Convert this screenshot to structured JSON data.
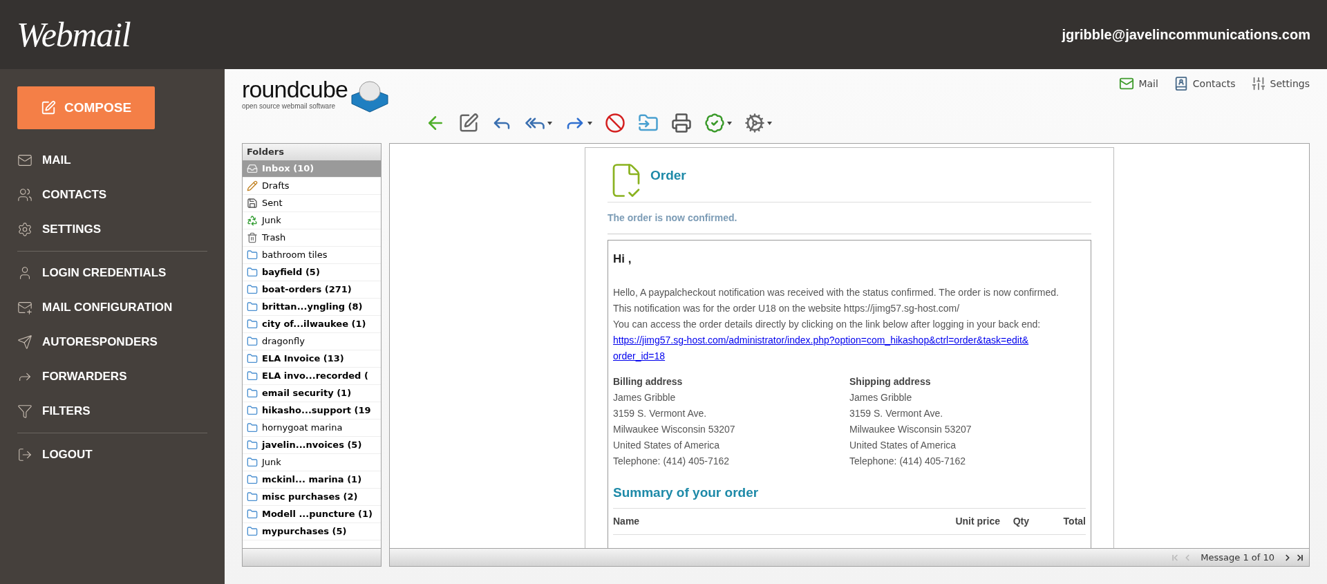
{
  "header": {
    "brand": "Webmail",
    "user": "jgribble@javelincommunications.com"
  },
  "sidebar": {
    "compose": "COMPOSE",
    "groups": [
      [
        "MAIL",
        "CONTACTS",
        "SETTINGS"
      ],
      [
        "LOGIN CREDENTIALS",
        "MAIL CONFIGURATION",
        "AUTORESPONDERS",
        "FORWARDERS",
        "FILTERS"
      ],
      [
        "LOGOUT"
      ]
    ]
  },
  "logo": {
    "name": "roundcube",
    "tagline": "open source webmail software"
  },
  "top_nav": [
    "Mail",
    "Contacts",
    "Settings"
  ],
  "folders": {
    "title": "Folders",
    "items": [
      {
        "kind": "inbox",
        "name": "Inbox (10)",
        "unread": true,
        "selected": true
      },
      {
        "kind": "drafts",
        "name": "Drafts",
        "unread": false,
        "selected": false
      },
      {
        "kind": "sent",
        "name": "Sent",
        "unread": false,
        "selected": false
      },
      {
        "kind": "junk",
        "name": "Junk",
        "unread": false,
        "selected": false
      },
      {
        "kind": "trash",
        "name": "Trash",
        "unread": false,
        "selected": false
      },
      {
        "kind": "folder",
        "name": "bathroom tiles",
        "unread": false,
        "selected": false
      },
      {
        "kind": "folder",
        "name": "bayfield (5)",
        "unread": true,
        "selected": false
      },
      {
        "kind": "folder",
        "name": "boat-orders (271)",
        "unread": true,
        "selected": false
      },
      {
        "kind": "folder",
        "name": "brittan...yngling (8)",
        "unread": true,
        "selected": false
      },
      {
        "kind": "folder",
        "name": "city of...ilwaukee (1)",
        "unread": true,
        "selected": false
      },
      {
        "kind": "folder",
        "name": "dragonfly",
        "unread": false,
        "selected": false
      },
      {
        "kind": "folder",
        "name": "ELA Invoice (13)",
        "unread": true,
        "selected": false
      },
      {
        "kind": "folder",
        "name": "ELA invo...recorded (",
        "unread": true,
        "selected": false
      },
      {
        "kind": "folder",
        "name": "email security (1)",
        "unread": true,
        "selected": false
      },
      {
        "kind": "folder",
        "name": "hikasho...support (19",
        "unread": true,
        "selected": false
      },
      {
        "kind": "folder",
        "name": "hornygoat marina",
        "unread": false,
        "selected": false
      },
      {
        "kind": "folder",
        "name": "javelin...nvoices (5)",
        "unread": true,
        "selected": false
      },
      {
        "kind": "folder",
        "name": "Junk",
        "unread": false,
        "selected": false
      },
      {
        "kind": "folder",
        "name": "mckinl... marina (1)",
        "unread": true,
        "selected": false
      },
      {
        "kind": "folder",
        "name": "misc purchases (2)",
        "unread": true,
        "selected": false
      },
      {
        "kind": "folder",
        "name": "Modell ...puncture (1)",
        "unread": true,
        "selected": false
      },
      {
        "kind": "folder",
        "name": "mypurchases (5)",
        "unread": true,
        "selected": false
      }
    ]
  },
  "message": {
    "title": "Order",
    "subtitle": "The order is now confirmed.",
    "greeting": "Hi ,",
    "lines": [
      "Hello, A paypalcheckout notification was received with the status confirmed. The order is now confirmed.",
      "This notification was for the order U18 on the website https://jimg57.sg-host.com/",
      "You can access the order details directly by clicking on the link below after logging in your back end:"
    ],
    "link_lines": [
      "https://jimg57.sg-host.com/administrator/index.php?option=com_hikashop&ctrl=order&task=edit&",
      "order_id=18"
    ],
    "addresses": [
      {
        "title": "Billing address",
        "lines": [
          "James Gribble",
          "3159 S. Vermont Ave.",
          "Milwaukee Wisconsin 53207",
          "United States of America",
          "Telephone: (414) 405-7162"
        ]
      },
      {
        "title": "Shipping address",
        "lines": [
          "James Gribble",
          "3159 S. Vermont Ave.",
          "Milwaukee Wisconsin 53207",
          "United States of America",
          "Telephone: (414) 405-7162"
        ]
      }
    ],
    "summary_title": "Summary of your order",
    "columns": [
      "Name",
      "Unit price",
      "Qty",
      "Total"
    ]
  },
  "pager": {
    "text": "Message 1 of 10",
    "first_disabled": true,
    "prev_disabled": true,
    "next_disabled": false,
    "last_disabled": false
  }
}
